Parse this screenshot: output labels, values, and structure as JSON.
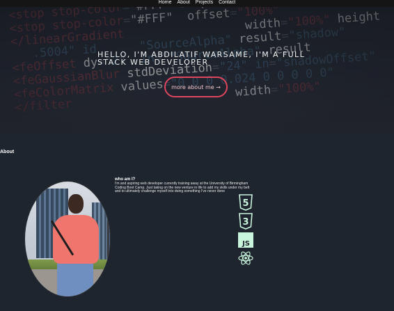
{
  "nav": {
    "items": [
      "Home",
      "About",
      "Projects",
      "Contact"
    ]
  },
  "hero": {
    "headline": "Hello, I'm Abdilatif Warsame, I'm a full stack web developer",
    "button_label": "more about me →",
    "accent_color": "#e0455e"
  },
  "about": {
    "section_title": "About",
    "who_title": "who am I?",
    "who_text": "I'm and aspiring web developer currently training away at the University of Birmingham Coding Boot Camp. Just taking on the new venture in life to add my skills under my belt and to ultimately challenge myself into doing something I've never done"
  },
  "skills": {
    "icons": [
      "html5-icon",
      "css3-icon",
      "javascript-icon",
      "react-icon"
    ],
    "js_label": "JS",
    "icon_color": "#c9f5dc"
  }
}
